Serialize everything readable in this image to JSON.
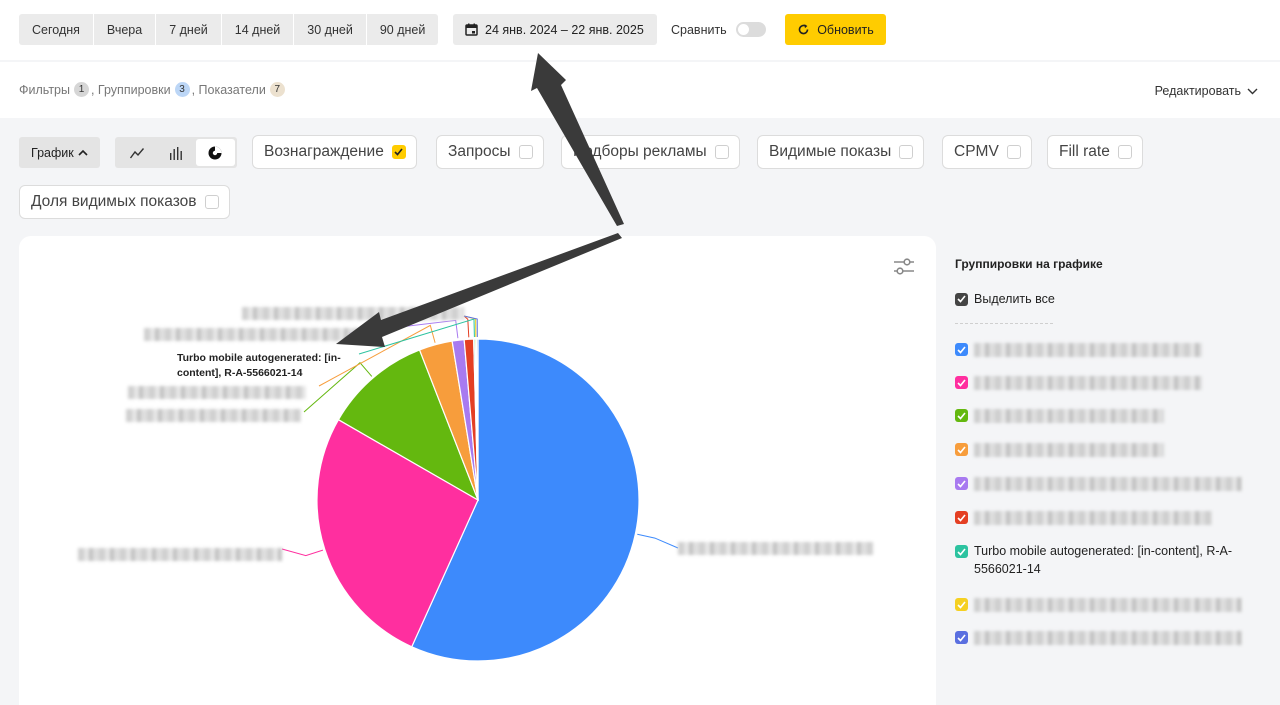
{
  "toolbar": {
    "periods": [
      "Сегодня",
      "Вчера",
      "7 дней",
      "14 дней",
      "30 дней",
      "90 дней"
    ],
    "date_range": "24 янв. 2024 – 22 янв. 2025",
    "compare_label": "Сравнить",
    "compare_enabled": false,
    "refresh_label": "Обновить"
  },
  "filters": {
    "filters_label": "Фильтры",
    "filters_count": "1",
    "groupings_label": ", Группировки",
    "groupings_count": "3",
    "metrics_label": ", Показатели",
    "metrics_count": "7",
    "edit_label": "Редактировать"
  },
  "chart_controls": {
    "chart_toggle_label": "График",
    "types": [
      "line-chart-icon",
      "bar-chart-icon",
      "pie-chart-icon"
    ],
    "active_type": "pie-chart-icon",
    "metrics": [
      {
        "label": "Вознаграждение",
        "checked": true
      },
      {
        "label": "Запросы",
        "checked": false
      },
      {
        "label": "Подборы рекламы",
        "checked": false
      },
      {
        "label": "Видимые показы",
        "checked": false
      },
      {
        "label": "CPMV",
        "checked": false
      },
      {
        "label": "Fill rate",
        "checked": false
      },
      {
        "label": "Доля видимых показов",
        "checked": false
      }
    ]
  },
  "chart_data": {
    "type": "pie",
    "highlighted_label": "Turbo mobile autogenerated: [in-content], R-A-5566021-14",
    "slices": [
      {
        "share": 0.5675,
        "color": "#3d8afc"
      },
      {
        "share": 0.2656,
        "color": "#ff2f9f"
      },
      {
        "share": 0.1078,
        "color": "#64b80f"
      },
      {
        "share": 0.0334,
        "color": "#f79d3c"
      },
      {
        "share": 0.012,
        "color": "#a87af0"
      },
      {
        "share": 0.0094,
        "color": "#e43f23"
      },
      {
        "share": 0.0015,
        "color": "#2cc3a0"
      },
      {
        "share": 0.0014,
        "color": "#f5d021"
      },
      {
        "share": 0.0014,
        "color": "#5a6fe0"
      }
    ]
  },
  "legend": {
    "title": "Группировки на графике",
    "select_all_label": "Выделить все",
    "items": [
      {
        "color": "#3d8afc",
        "label": ""
      },
      {
        "color": "#ff2f9f",
        "label": ""
      },
      {
        "color": "#64b80f",
        "label": ""
      },
      {
        "color": "#f79d3c",
        "label": ""
      },
      {
        "color": "#a87af0",
        "label": ""
      },
      {
        "color": "#e43f23",
        "label": ""
      },
      {
        "color": "#2cc3a0",
        "label": "Turbo mobile autogenerated: [in-content], R-A-5566021-14"
      },
      {
        "color": "#f5d021",
        "label": ""
      },
      {
        "color": "#5a6fe0",
        "label": ""
      }
    ]
  }
}
